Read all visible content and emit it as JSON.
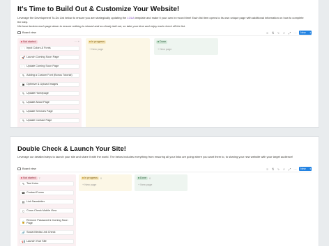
{
  "top": {
    "title": "It's Time to Build Out & Customize Your Website!",
    "intro_before_link": "Leverage the Development To-Do List below to ensure you are strategically updating the ",
    "intro_link": "LOLA",
    "intro_after_link": " template and make it your own in record time! Each list item opens to its own unique page with additional information on how to complete the step.",
    "intro_italic": "We have broken each page down to ensure nothing is missed and as clearly laid out, so take your time and enjoy each check off the list.",
    "view_label": "Board view",
    "new_label": "New",
    "columns": [
      {
        "status": "Not started",
        "count": "",
        "new_page": ""
      },
      {
        "status": "In progress",
        "count": "",
        "new_page": "New page"
      },
      {
        "status": "Done",
        "count": "",
        "new_page": "New page"
      }
    ],
    "cards": [
      {
        "icon": "folder-icon",
        "glyph": "🗀",
        "label": "Input Colors & Fonts"
      },
      {
        "icon": "rocket-icon",
        "glyph": "🚀",
        "label": "Launch Coming Soon Page"
      },
      {
        "icon": "folder-icon",
        "glyph": "🗀",
        "label": "Update Coming Soon Page"
      },
      {
        "icon": "pencil-icon",
        "glyph": "✎",
        "label": "Adding a Custom Font (Bonus Tutorial)"
      },
      {
        "icon": "camera-icon",
        "glyph": "▣",
        "label": "Optimize & Upload Images"
      },
      {
        "icon": "pencil-icon",
        "glyph": "✎",
        "label": "Update Homepage"
      },
      {
        "icon": "pencil-icon",
        "glyph": "✎",
        "label": "Update About Page"
      },
      {
        "icon": "pencil-icon",
        "glyph": "✎",
        "label": "Update Services Page"
      },
      {
        "icon": "pencil-icon",
        "glyph": "✎",
        "label": "Update Contact Page"
      }
    ]
  },
  "bottom": {
    "title": "Double Check & Launch Your Site!",
    "intro": "Leverage our detailed steps to launch your site and share it with the world. The below includes everything from ensuring all your links are going where you want them to, to sharing your new website with your target audience!",
    "view_label": "Board view",
    "new_label": "New",
    "columns": [
      {
        "status": "Not started",
        "count": "7",
        "new_page": ""
      },
      {
        "status": "In progress",
        "count": "0",
        "new_page": "New page"
      },
      {
        "status": "Done",
        "count": "0",
        "new_page": "New page"
      }
    ],
    "cards": [
      {
        "icon": "pencil-icon",
        "glyph": "✎",
        "label": "Test Links"
      },
      {
        "icon": "phone-icon",
        "glyph": "☎",
        "label": "Contact Forms"
      },
      {
        "icon": "newsletter-icon",
        "glyph": "▤",
        "label": "Link Newsletter"
      },
      {
        "icon": "mobile-icon",
        "glyph": "▯",
        "label": "Cross Check Mobile View"
      },
      {
        "icon": "lock-icon",
        "glyph": "🔒",
        "label": "Remove Password & Coming Soon Page"
      },
      {
        "icon": "link-icon",
        "glyph": "🔗",
        "label": "Social Media Link Check"
      },
      {
        "icon": "megaphone-icon",
        "glyph": "📢",
        "label": "Launch Your Site"
      }
    ]
  },
  "colors": {
    "accent": "#2383e2",
    "link": "#7b3fb8",
    "not_started_bg": "#fbf0f2",
    "in_progress_bg": "#fcf7e6",
    "done_bg": "#eef5f0"
  }
}
